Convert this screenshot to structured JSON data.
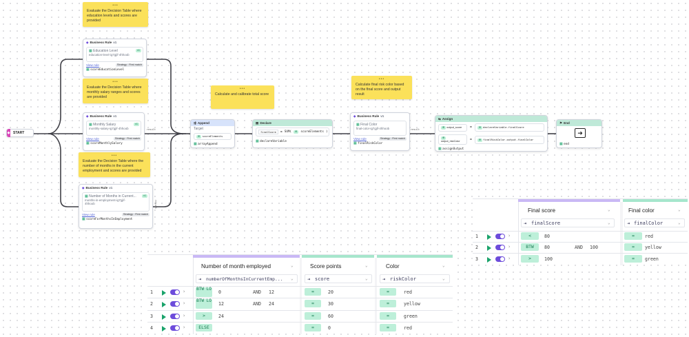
{
  "start": {
    "label": "START"
  },
  "notes": [
    "Evaluate the Decision Table where education levels and scores are provided",
    "Evaluate the Decision Table where monthly salary ranges and scores are provided",
    "Evaluate the Decision Table where the number of months in the current employment and scores are provided",
    "Calculate and calibrate total score",
    "Calculate final risk color based on the final score and output result"
  ],
  "nodes": {
    "br1": {
      "type": "Business Rule",
      "version": "v1",
      "name": "Education Level",
      "path": "education-level-ig7gjif-4hhoob",
      "view": "View rule",
      "strategy": "Strategy : First match",
      "output": "scoreEducationLevel"
    },
    "br2": {
      "type": "Business Rule",
      "version": "v1",
      "name": "Monthly Salary",
      "path": "monthly-salary-ig7gjif-4hhoob",
      "view": "View rule",
      "strategy": "Strategy : First match",
      "output": "scoreMonthlySalary"
    },
    "br3": {
      "type": "Business Rule",
      "version": "v1",
      "name": "Number of Months in Current...",
      "path": "months-in-employment-ig7gjif-4hhoob",
      "view": "View rule",
      "strategy": "Strategy : First match",
      "output": "scoreForMonthsInEmployment"
    },
    "append": {
      "type": "Append",
      "target_label": "Target",
      "target": "scoreElements",
      "output": "arrayAppend"
    },
    "declare": {
      "type": "Declare",
      "var": "finalScore",
      "eq": "=",
      "expr": "SUM(",
      "arg": "scoreElements",
      "close": ")",
      "output": "declareVariable"
    },
    "br4": {
      "type": "Business Rule",
      "version": "v1",
      "name": "Final Color",
      "path": "final-color-ig7gjif-4hhoob",
      "view": "View rule",
      "strategy": "Strategy : First match",
      "output": "finalRiskColor"
    },
    "assign": {
      "type": "Assign",
      "rows": [
        {
          "left": "output_score",
          "op": "=",
          "right": "declareVariable.finalScore"
        },
        {
          "left": "output_riskColor",
          "op": "=",
          "right": "finalRiskColor.output.finalColor"
        }
      ],
      "output": "assignOutput"
    },
    "end": {
      "type": "End",
      "output": "end"
    }
  },
  "edge_labels": {
    "result": "result",
    "output": "output"
  },
  "table_final": {
    "columns": [
      {
        "title": "Final score",
        "variable": "finalScore"
      },
      {
        "title": "Final color",
        "variable": "finalColor"
      }
    ],
    "rows": [
      {
        "num": "1",
        "op": "<",
        "v1": "80",
        "and": "",
        "v2": "",
        "out_op": "=",
        "out": "red"
      },
      {
        "num": "2",
        "op": "BTW",
        "v1": "80",
        "and": "AND",
        "v2": "100",
        "out_op": "=",
        "out": "yellow"
      },
      {
        "num": "3",
        "op": ">",
        "v1": "100",
        "and": "",
        "v2": "",
        "out_op": "=",
        "out": "green"
      }
    ]
  },
  "table_months": {
    "columns": [
      {
        "title": "Number of month employed",
        "variable": "numberOfMonthsInCurrentEmp..."
      },
      {
        "title": "Score points",
        "variable": "score"
      },
      {
        "title": "Color",
        "variable": "riskColor"
      }
    ],
    "rows": [
      {
        "num": "1",
        "op": "BTW LO",
        "v1": "0",
        "and": "AND",
        "v2": "12",
        "s_op": "=",
        "score": "20",
        "c_op": "=",
        "color": "red"
      },
      {
        "num": "2",
        "op": "BTW LO",
        "v1": "12",
        "and": "AND",
        "v2": "24",
        "s_op": "=",
        "score": "30",
        "c_op": "=",
        "color": "yellow"
      },
      {
        "num": "3",
        "op": ">",
        "v1": "24",
        "and": "",
        "v2": "",
        "s_op": "=",
        "score": "60",
        "c_op": "=",
        "color": "green"
      },
      {
        "num": "4",
        "op": "ELSE",
        "v1": "",
        "and": "",
        "v2": "",
        "s_op": "=",
        "score": "0",
        "c_op": "=",
        "color": "red"
      }
    ]
  },
  "colors": {
    "purple": "#6d4cdb",
    "green": "#1aa36b",
    "note": "#fbe15a",
    "start": "#d946b8"
  }
}
